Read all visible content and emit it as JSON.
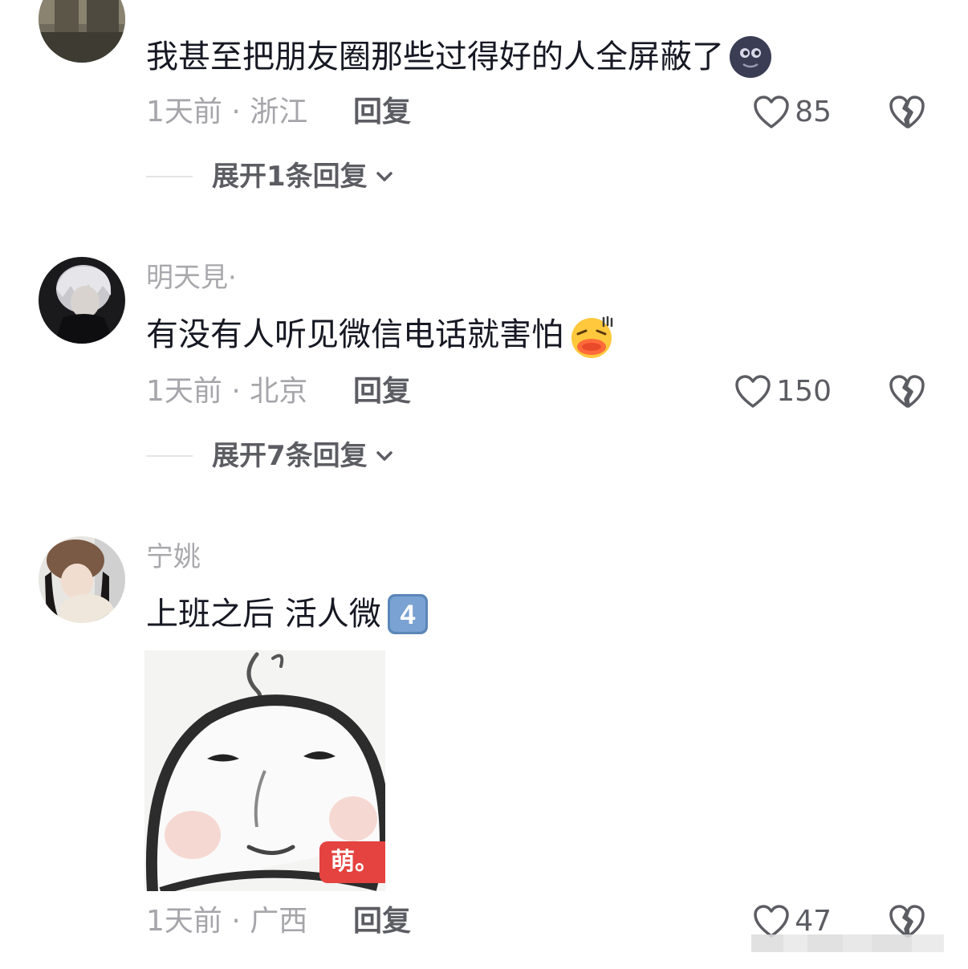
{
  "comments": [
    {
      "username": "",
      "text": "我甚至把朋友圈那些过得好的人全屏蔽了",
      "emoji": "dark-moon-face-emoji",
      "meta": "1天前 · 浙江",
      "reply_label": "回复",
      "likes": "85",
      "expand_label": "展开1条回复"
    },
    {
      "username": "明天見·",
      "text": "有没有人听见微信电话就害怕",
      "emoji": "scared-face-emoji",
      "meta": "1天前 · 北京",
      "reply_label": "回复",
      "likes": "150",
      "expand_label": "展开7条回复"
    },
    {
      "username": "宁姚",
      "text": "上班之后 活人微",
      "emoji": "keycap-4-emoji",
      "sticker_badge": "萌。",
      "meta": "1天前 · 广西",
      "reply_label": "回复",
      "likes": "47"
    }
  ],
  "colors": {
    "text_primary": "#161823",
    "text_secondary": "#a5a5aa",
    "action": "#5c5d63",
    "badge": "#e4433f"
  }
}
